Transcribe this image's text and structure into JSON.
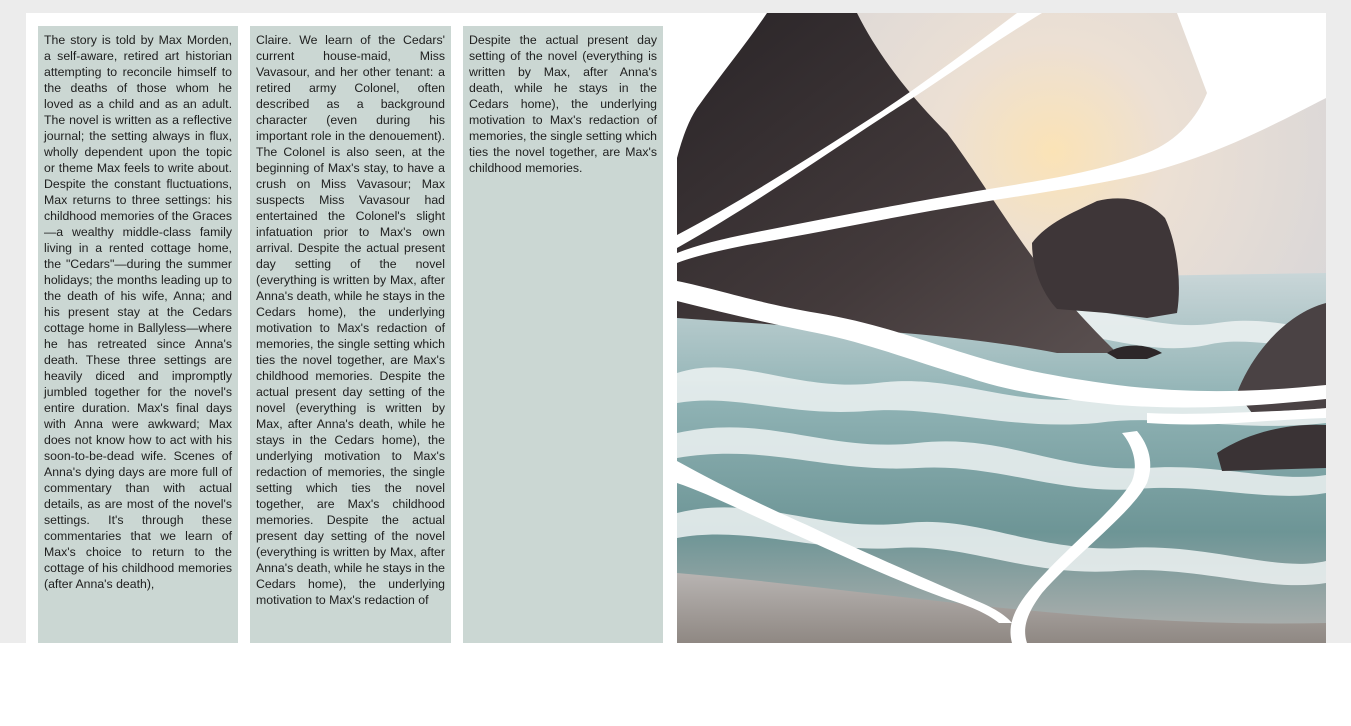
{
  "article": {
    "columns": [
      {
        "text": "The story is told by Max Morden, a self-aware, retired art historian attempting to reconcile himself to the deaths of those whom he loved as a child and as an adult. The novel is written as a reflective journal; the setting always in flux, wholly dependent upon the topic or theme Max feels to write about. Despite the constant fluctuations, Max returns to three settings: his childhood memories of the Graces—a wealthy middle-class family living in a rented cottage home, the \"Cedars\"—during the summer holidays; the months leading up to the death of his wife, Anna; and his present stay at the Cedars cottage home in Ballyless—where he has retreated since Anna's death. These three settings are heavily diced and impromptly jumbled together for the novel's entire duration. Max's final days with Anna were awkward; Max does not know how to act with his soon-to-be-dead wife. Scenes of Anna's dying days are more full of commentary than with actual details, as are most of the novel's settings. It's through these commentaries that we learn of Max's choice to return to the cottage of his childhood memories (after Anna's death),"
      },
      {
        "text": "Claire. We learn of the Cedars' current house-maid, Miss Vavasour, and her other tenant: a retired army Colonel, often described as a background character (even during his important role in the denouement). The Colonel is also seen, at the beginning of Max's stay, to have a crush on Miss Vavasour; Max suspects Miss Vavasour had entertained the Colonel's slight infatuation prior to Max's own arrival. Despite the actual present day setting of the novel (everything is written by Max, after Anna's death, while he stays in the Cedars home), the underlying motivation to Max's redaction of memories, the single setting which ties the novel together, are Max's childhood memories. Despite the actual present day setting of the novel (everything is written by Max, after Anna's death, while he stays in the Cedars home), the underlying motivation to Max's redaction of memories, the single setting which ties the novel together, are Max's childhood memories. Despite the actual present day setting of the novel (everything is written by Max, after Anna's death, while he stays in the Cedars home), the underlying motivation to Max's redaction of"
      },
      {
        "text": "Despite the actual present day setting of the novel (everything is written by Max, after Anna's death, while he stays in the Cedars home), the underlying motivation to Max's redaction of memories, the single setting which ties the novel together, are Max's childhood memories."
      }
    ]
  },
  "photo": {
    "icon": "shattered-seascape-image",
    "colors": {
      "sky": "#efeae6",
      "sun_glow": "#f7dfb4",
      "rock": "#3a3336",
      "sea": "#7fa5a8",
      "foam": "#e8eeef",
      "sand": "#a49c98",
      "column_bg": "#cbd7d3",
      "backdrop": "#ececec"
    }
  }
}
